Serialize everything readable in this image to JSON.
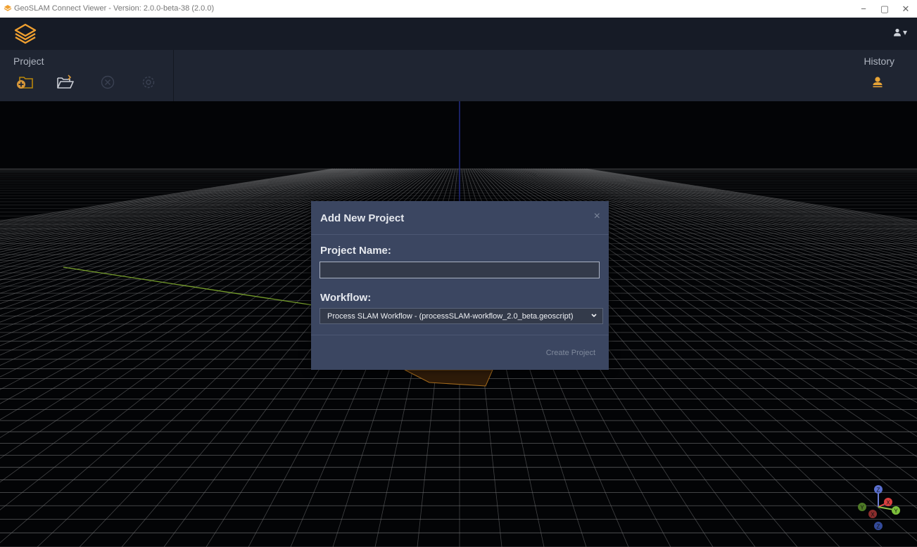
{
  "window": {
    "title": "GeoSLAM Connect Viewer - Version: 2.0.0-beta-38 (2.0.0)",
    "min_label": "−",
    "max_label": "▢",
    "close_label": "✕"
  },
  "header": {
    "user_caret": "▾"
  },
  "toolbar": {
    "project_label": "Project",
    "history_label": "History"
  },
  "dialog": {
    "title": "Add New Project",
    "close_label": "×",
    "name_label": "Project Name:",
    "name_value": "",
    "workflow_label": "Workflow:",
    "workflow_selected": "Process SLAM Workflow - (processSLAM-workflow_2.0_beta.geoscript)",
    "create_label": "Create Project"
  },
  "axis_gizmo": {
    "labels": [
      "Z",
      "X",
      "Y",
      "X",
      "Y",
      "Z"
    ]
  },
  "colors": {
    "accent": "#f0a030",
    "dialog_bg": "#3b4661",
    "toolbar_bg": "#1f2532",
    "grid": "#9a9a9a"
  }
}
